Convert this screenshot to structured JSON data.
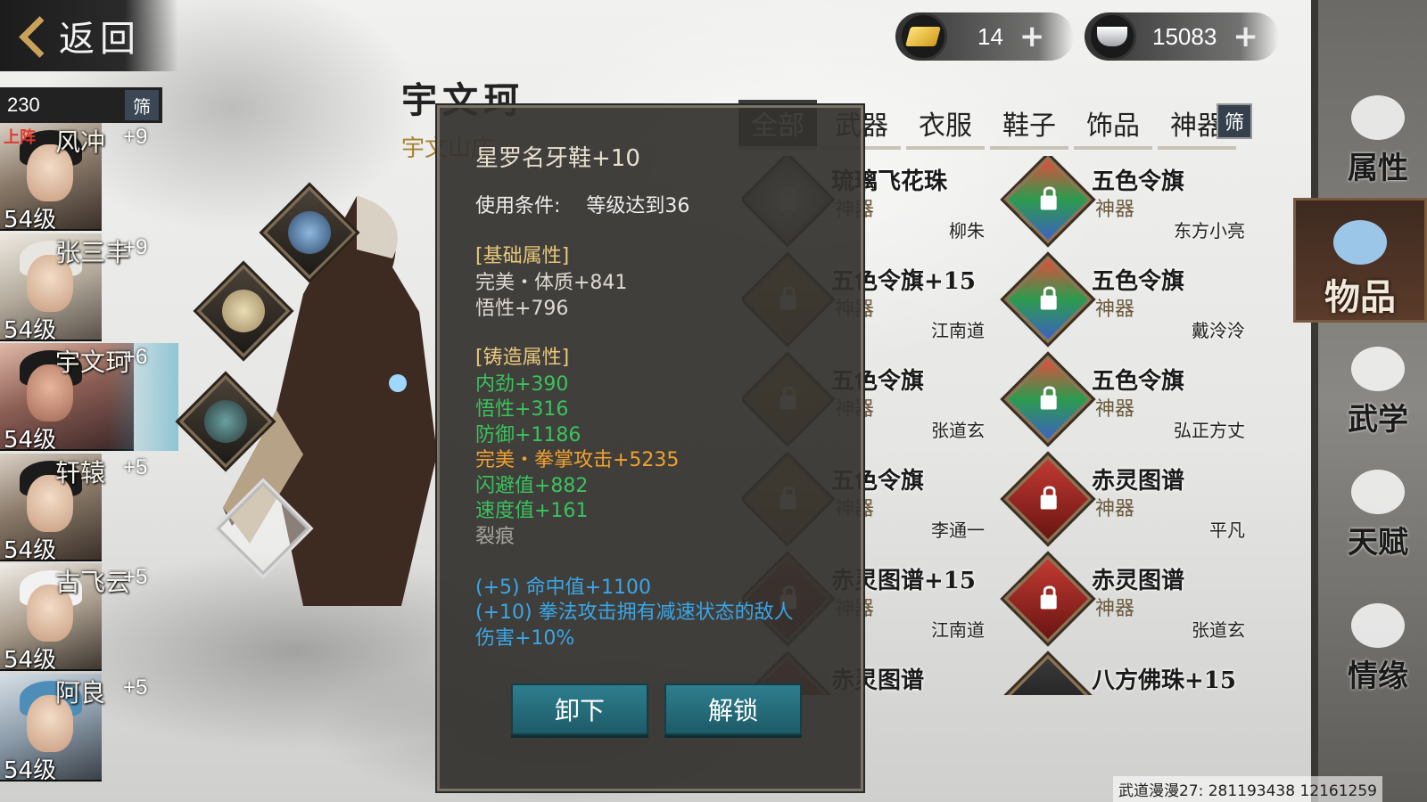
{
  "nav": {
    "back_label": "返回"
  },
  "currency": {
    "gold": {
      "icon": "gold-ingot-icon",
      "amount": "14"
    },
    "silver": {
      "icon": "silver-ingot-icon",
      "amount": "15083"
    }
  },
  "roster": {
    "count": "230",
    "filter_label": "筛",
    "deployed_tag": "上阵",
    "heroes": [
      {
        "name": "风冲",
        "bonus": "+9",
        "level": "54级"
      },
      {
        "name": "张三丰",
        "bonus": "+9",
        "level": "54级"
      },
      {
        "name": "宇文珂",
        "bonus": "+6",
        "level": "54级"
      },
      {
        "name": "轩辕",
        "bonus": "+5",
        "level": "54级"
      },
      {
        "name": "古飞云",
        "bonus": "+5",
        "level": "54级"
      },
      {
        "name": "阿良",
        "bonus": "+5",
        "level": "54级"
      }
    ]
  },
  "character": {
    "name": "宇文珂",
    "subtitle": "宇文山庄"
  },
  "tabs": {
    "items": [
      "全部",
      "武器",
      "衣服",
      "鞋子",
      "饰品",
      "神器"
    ],
    "filter_label": "筛"
  },
  "grid": {
    "items": [
      {
        "name": "琉璃飞花珠",
        "type": "神器",
        "owner": "柳朱"
      },
      {
        "name": "五色令旗",
        "type": "神器",
        "owner": "东方小亮"
      },
      {
        "name": "五色令旗+15",
        "type": "神器",
        "owner": "江南道"
      },
      {
        "name": "五色令旗",
        "type": "神器",
        "owner": "戴泠泠"
      },
      {
        "name": "五色令旗",
        "type": "神器",
        "owner": "张道玄"
      },
      {
        "name": "五色令旗",
        "type": "神器",
        "owner": "弘正方丈"
      },
      {
        "name": "五色令旗",
        "type": "神器",
        "owner": "李通一"
      },
      {
        "name": "赤灵图谱",
        "type": "神器",
        "owner": "平凡"
      },
      {
        "name": "赤灵图谱+15",
        "type": "神器",
        "owner": "江南道"
      },
      {
        "name": "赤灵图谱",
        "type": "神器",
        "owner": "张道玄"
      },
      {
        "name": "赤灵图谱",
        "type": "",
        "owner": ""
      },
      {
        "name": "八方佛珠+15",
        "type": "",
        "owner": ""
      }
    ]
  },
  "side_nav": [
    "属性",
    "物品",
    "武学",
    "天赋",
    "情缘"
  ],
  "popup": {
    "title": "星罗名牙鞋+10",
    "condition_label": "使用条件:",
    "condition_value": "等级达到36",
    "base_header": "[基础属性]",
    "base_lines": [
      "完美・体质+841",
      "悟性+796"
    ],
    "forge_header": "[铸造属性]",
    "forge_lines": [
      "内劲+390",
      "悟性+316",
      "防御+1186",
      "完美・拳掌攻击+5235",
      "闪避值+882",
      "速度值+161",
      "裂痕"
    ],
    "bonus_lines": [
      "(+5) 命中值+1100",
      "(+10) 拳法攻击拥有减速状态的敌人",
      "伤害+10%"
    ],
    "btn_unequip": "卸下",
    "btn_unlock": "解锁",
    "colors": {
      "green": "#3bc25e",
      "orange": "#f0a12e",
      "blue": "#3aa6e6"
    }
  },
  "footer": "武道漫漫27: 281193438  12161259"
}
